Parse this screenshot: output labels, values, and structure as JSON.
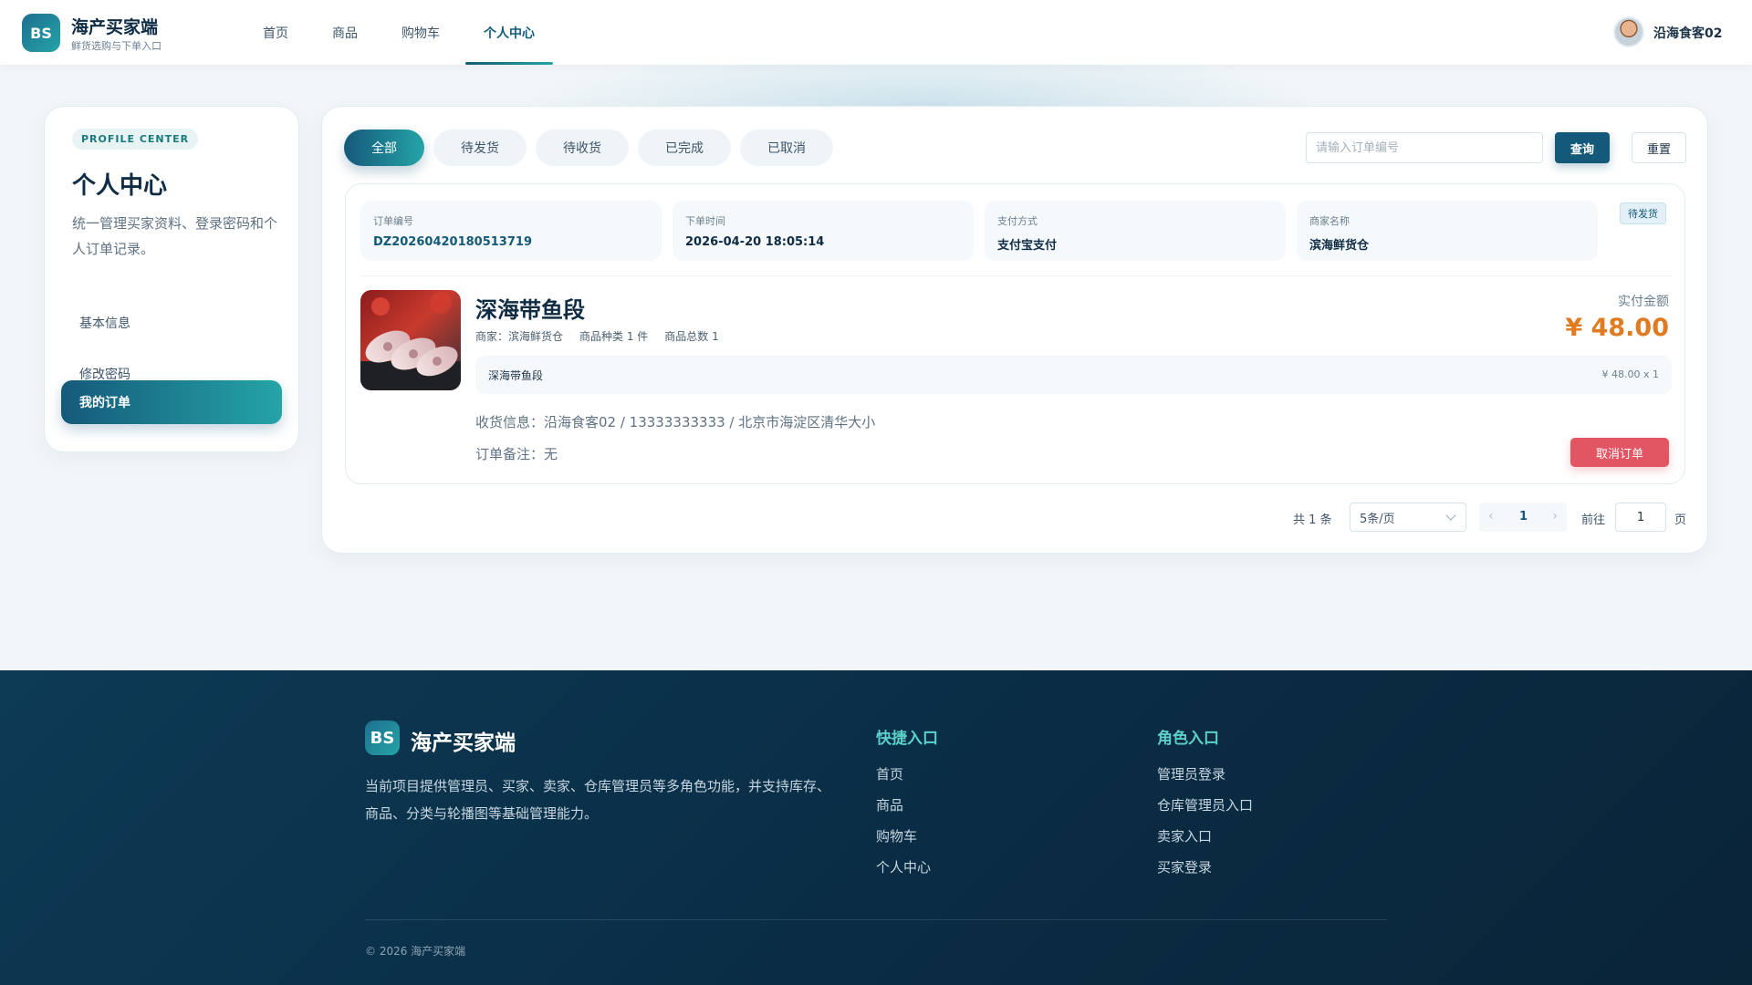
{
  "header": {
    "logo_text": "BS",
    "brand_title": "海产买家端",
    "brand_subtitle": "鲜货选购与下单入口",
    "nav": [
      {
        "label": "首页"
      },
      {
        "label": "商品"
      },
      {
        "label": "购物车"
      },
      {
        "label": "个人中心",
        "active": true
      }
    ],
    "user_name": "沿海食客02"
  },
  "sidebar": {
    "tag": "PROFILE CENTER",
    "title": "个人中心",
    "description": "统一管理买家资料、登录密码和个人订单记录。",
    "items": [
      {
        "label": "基本信息"
      },
      {
        "label": "修改密码"
      },
      {
        "label": "我的订单",
        "active": true
      }
    ]
  },
  "orders": {
    "tabs": [
      {
        "label": "全部",
        "active": true
      },
      {
        "label": "待发货"
      },
      {
        "label": "待收货"
      },
      {
        "label": "已完成"
      },
      {
        "label": "已取消"
      }
    ],
    "search_placeholder": "请输入订单编号",
    "search_value": "",
    "query_label": "查询",
    "reset_label": "重置",
    "order": {
      "meta": [
        {
          "label": "订单编号",
          "value": "DZ20260420180513719"
        },
        {
          "label": "下单时间",
          "value": "2026-04-20 18:05:14"
        },
        {
          "label": "支付方式",
          "value": "支付宝支付"
        },
        {
          "label": "商家名称",
          "value": "滨海鲜货仓"
        }
      ],
      "status": "待发货",
      "product_name": "深海带鱼段",
      "merchant_info": "商家：滨海鲜货仓",
      "category_info": "商品种类 1 件",
      "total_info": "商品总数 1",
      "paid_label": "实付金额",
      "paid_amount": "¥ 48.00",
      "item_name": "深海带鱼段",
      "item_price": "¥ 48.00 x 1",
      "address": "收货信息：沿海食客02 / 13333333333 / 北京市海淀区清华大小",
      "note": "订单备注：无",
      "cancel_label": "取消订单"
    },
    "pagination": {
      "total": "共 1 条",
      "page_size": "5条/页",
      "current": "1",
      "prev": "‹",
      "next": "›",
      "goto_label": "前往",
      "goto_value": "1",
      "unit": "页"
    }
  },
  "footer": {
    "logo_text": "BS",
    "title": "海产买家端",
    "description": "当前项目提供管理员、买家、卖家、仓库管理员等多角色功能，并支持库存、商品、分类与轮播图等基础管理能力。",
    "quick_title": "快捷入口",
    "quick_links": [
      "首页",
      "商品",
      "购物车",
      "个人中心"
    ],
    "role_title": "角色入口",
    "role_links": [
      "管理员登录",
      "仓库管理员入口",
      "卖家入口",
      "买家登录"
    ],
    "copyright": "© 2026 海产买家端"
  },
  "colors": {
    "primary": "#15597a",
    "accent": "#25a4a7",
    "price": "#e07b21",
    "danger": "#e25563",
    "footer_bg": "#0a2c44"
  }
}
